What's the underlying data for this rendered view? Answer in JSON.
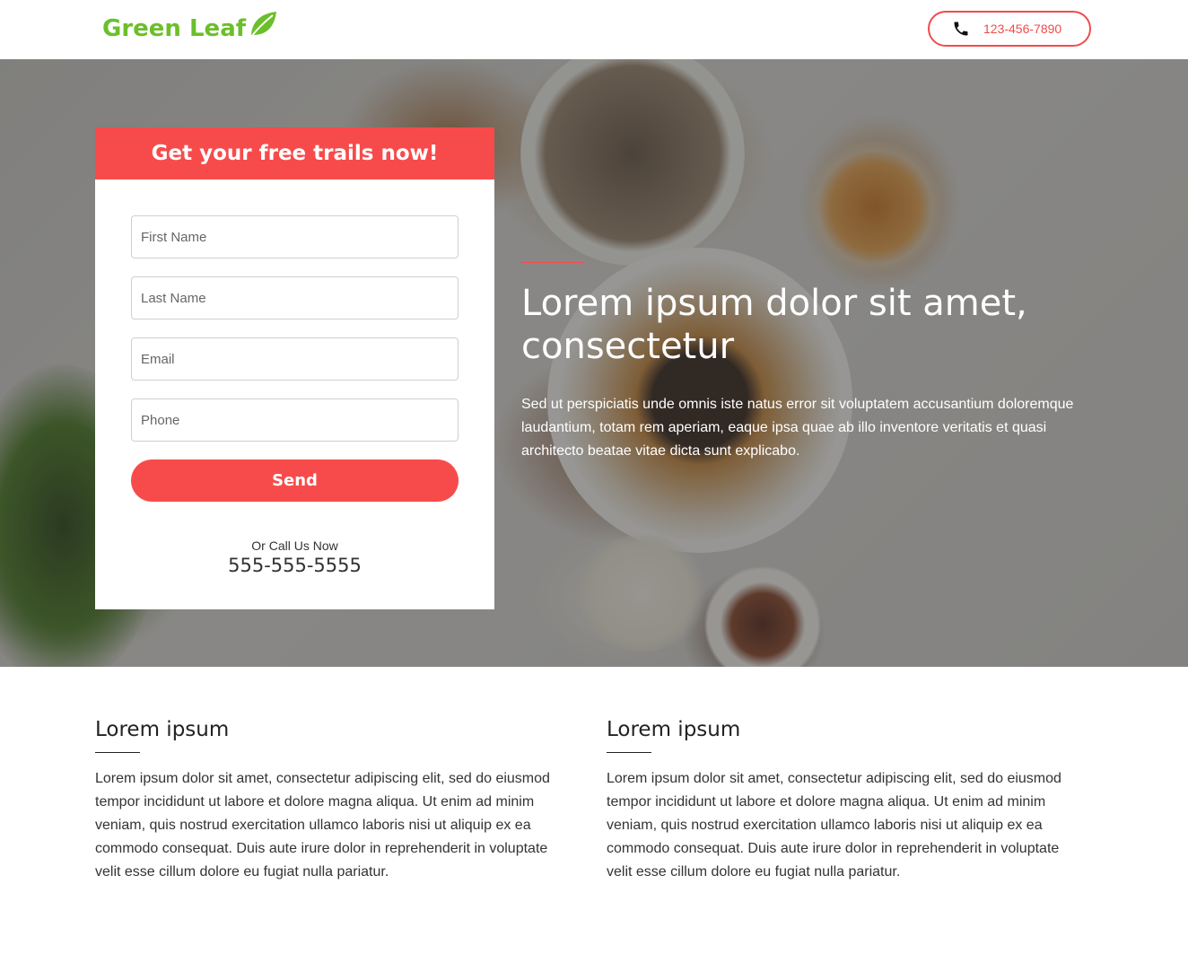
{
  "header": {
    "logo_text": "Green Leaf",
    "logo_icon": "leaf-icon",
    "phone_icon": "phone-icon",
    "phone_number": "123-456-7890",
    "accent_color": "#f24b4b",
    "logo_color": "#6bbf2a"
  },
  "form": {
    "title": "Get your free trails now!",
    "fields": {
      "first_name_placeholder": "First Name",
      "last_name_placeholder": "Last Name",
      "email_placeholder": "Email",
      "phone_placeholder": "Phone"
    },
    "send_label": "Send",
    "call_label": "Or Call Us Now",
    "call_number": "555-555-5555"
  },
  "hero": {
    "title": "Lorem ipsum dolor sit amet, consectetur",
    "description": "Sed ut perspiciatis unde omnis iste natus error sit voluptatem accusantium doloremque laudantium, totam rem aperiam, eaque ipsa quae ab illo inventore veritatis et quasi architecto beatae vitae dicta sunt explicabo."
  },
  "columns": [
    {
      "heading": "Lorem ipsum",
      "body": "Lorem ipsum dolor sit amet, consectetur adipiscing elit, sed do eiusmod tempor incididunt ut labore et dolore magna aliqua. Ut enim ad minim veniam, quis nostrud exercitation ullamco laboris nisi ut aliquip ex ea commodo consequat. Duis aute irure dolor in reprehenderit in voluptate velit esse cillum dolore eu fugiat nulla pariatur."
    },
    {
      "heading": "Lorem ipsum",
      "body": "Lorem ipsum dolor sit amet, consectetur adipiscing elit, sed do eiusmod tempor incididunt ut labore et dolore magna aliqua. Ut enim ad minim veniam, quis nostrud exercitation ullamco laboris nisi ut aliquip ex ea commodo consequat. Duis aute irure dolor in reprehenderit in voluptate velit esse cillum dolore eu fugiat nulla pariatur."
    }
  ]
}
